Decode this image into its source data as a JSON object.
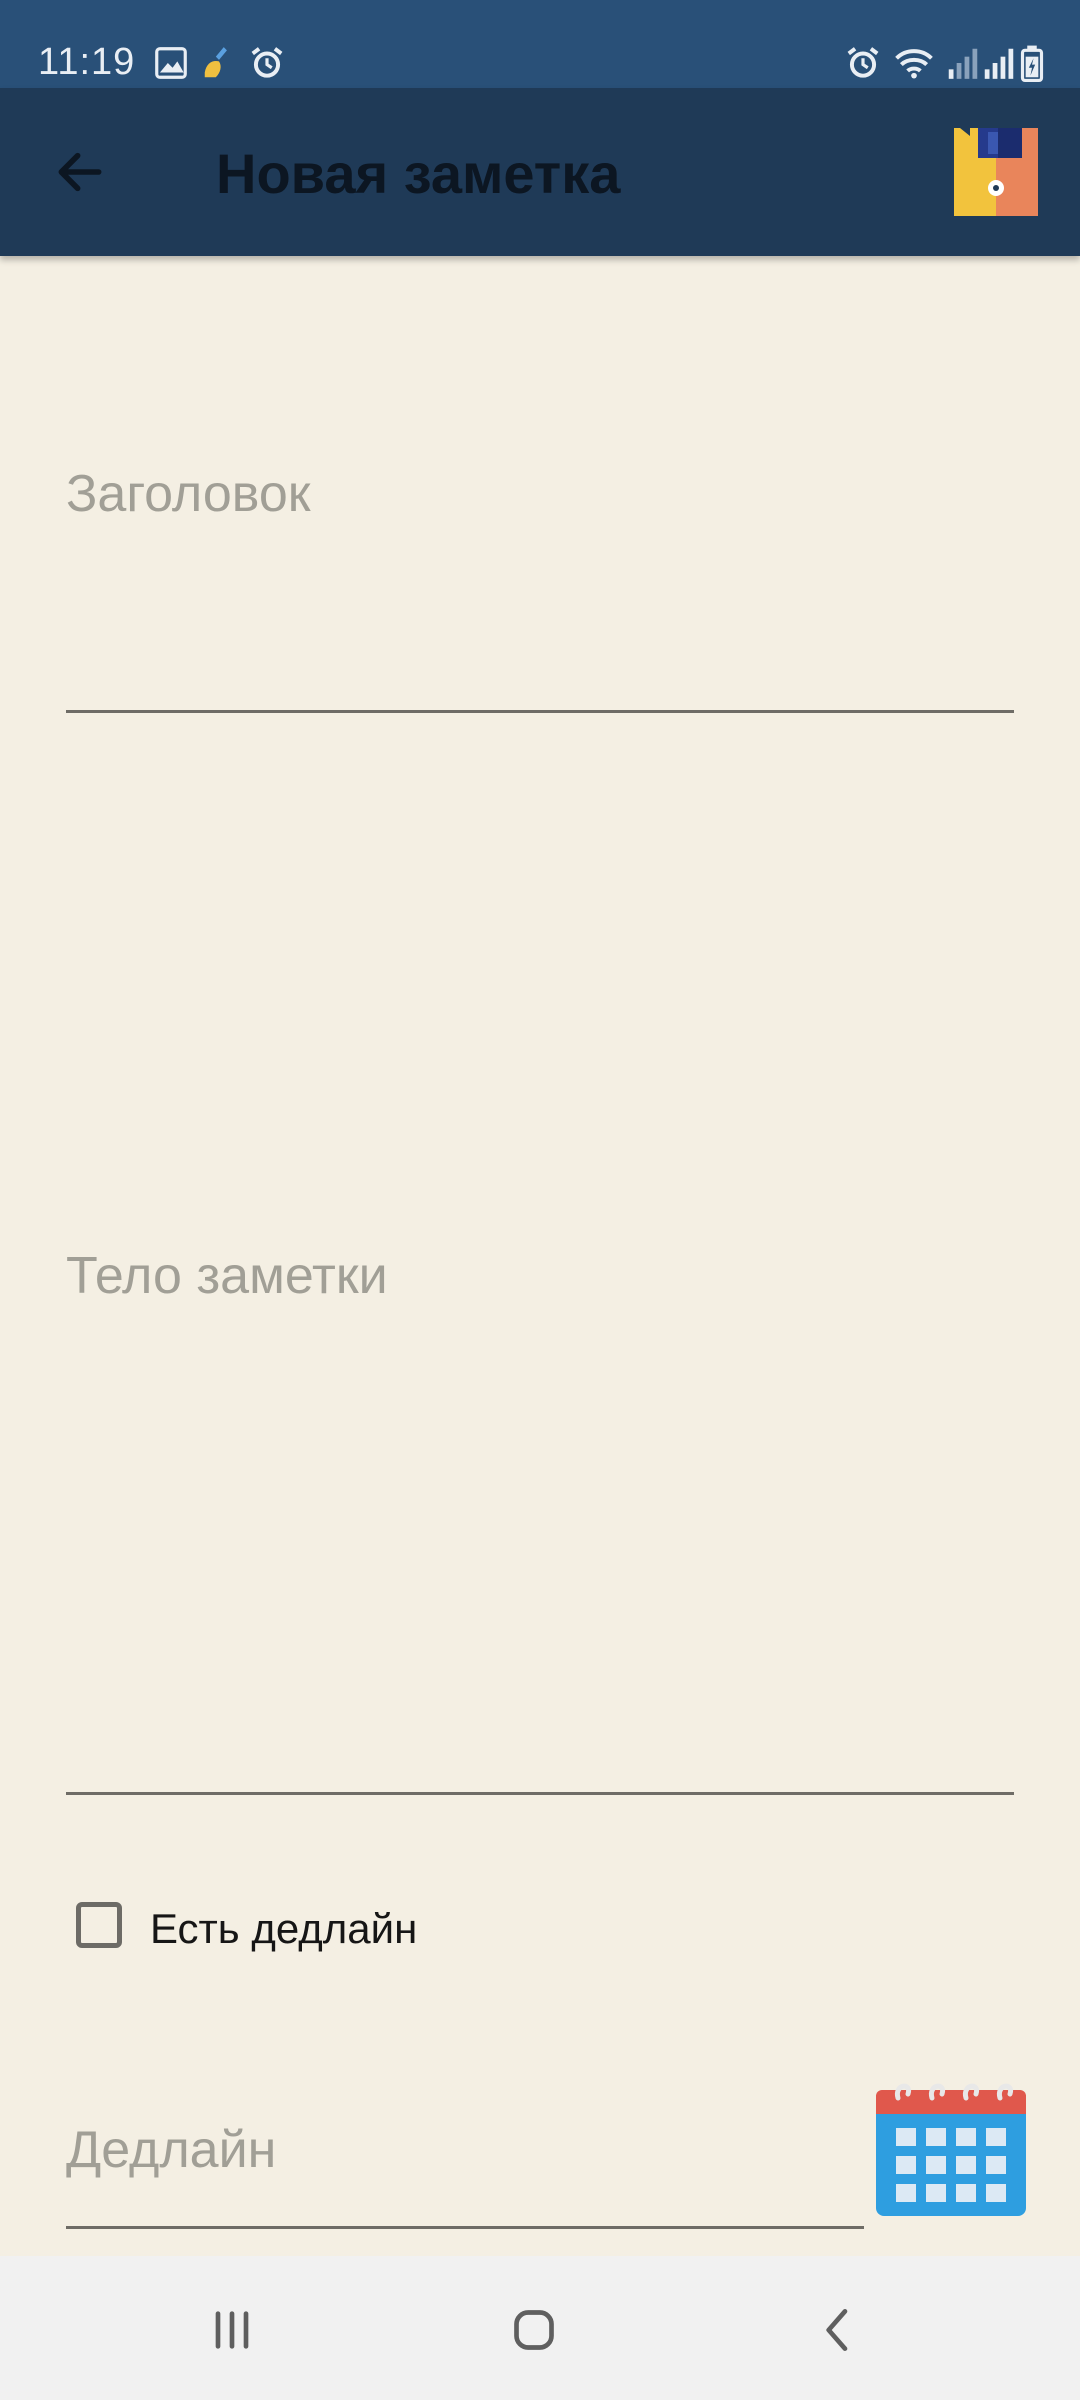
{
  "status_bar": {
    "time": "11:19",
    "left_icons": [
      "image-icon",
      "cleaner-icon",
      "alarm-icon"
    ],
    "right_icons": [
      "alarm-icon",
      "wifi-icon",
      "signal-icon",
      "signal-icon",
      "battery-icon"
    ]
  },
  "app_bar": {
    "title": "Новая заметка",
    "back_icon": "arrow-left-icon",
    "save_icon": "floppy-disk-icon"
  },
  "form": {
    "title_placeholder": "Заголовок",
    "body_placeholder": "Тело заметки",
    "deadline_checkbox_label": "Есть дедлайн",
    "deadline_checked": false,
    "deadline_placeholder": "Дедлайн",
    "calendar_icon": "calendar-icon"
  },
  "navigation_bar": {
    "buttons": [
      "recents-icon",
      "home-icon",
      "back-icon"
    ]
  },
  "colors": {
    "status_bar": "#295078",
    "app_bar": "#1f3a57",
    "background": "#f4efe3",
    "placeholder": "#a19f96",
    "nav_bar": "#f1f1f1"
  }
}
